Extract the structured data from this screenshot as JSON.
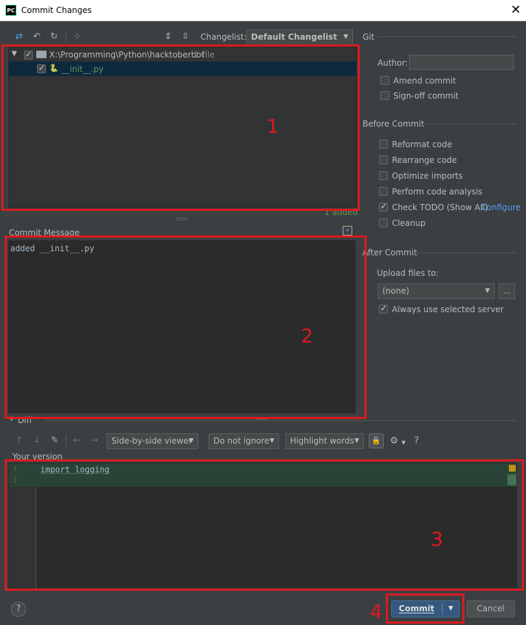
{
  "window": {
    "app_icon": "PC",
    "title": "Commit Changes",
    "close": "✕"
  },
  "toolbar": {
    "changelist_label": "Changelist:",
    "changelist_value": "Default Changelist"
  },
  "tree": {
    "root_label": "X:\\Programming\\Python\\hacktoberbot",
    "root_count": "1 file",
    "file_label": "__init__.py",
    "status_added": "1 added"
  },
  "commit_message": {
    "header": "Commit Message",
    "text": "added __init__.py"
  },
  "git": {
    "header": "Git",
    "author_label": "Author:",
    "author_value": "",
    "amend": "Amend commit",
    "signoff": "Sign-off commit"
  },
  "before_commit": {
    "header": "Before Commit",
    "options": [
      {
        "label": "Reformat code",
        "checked": false
      },
      {
        "label": "Rearrange code",
        "checked": false
      },
      {
        "label": "Optimize imports",
        "checked": false
      },
      {
        "label": "Perform code analysis",
        "checked": false
      },
      {
        "label": "Check TODO (Show All)",
        "checked": true
      },
      {
        "label": "Cleanup",
        "checked": false
      }
    ],
    "configure_link": "Configure"
  },
  "after_commit": {
    "header": "After Commit",
    "upload_label": "Upload files to:",
    "upload_value": "(none)",
    "browse": "...",
    "always_use": "Always use selected server"
  },
  "diff": {
    "header": "Diff",
    "viewer_mode": "Side-by-side viewer",
    "ignore_mode": "Do not ignore",
    "highlight_mode": "Highlight words",
    "help": "?",
    "your_version": "Your version",
    "lines": [
      {
        "num": "1",
        "code": "import logging"
      },
      {
        "num": "2",
        "code": ""
      }
    ]
  },
  "annotations": [
    "1",
    "2",
    "3",
    "4"
  ],
  "buttons": {
    "help": "?",
    "commit": "Commit",
    "cancel": "Cancel"
  },
  "colors": {
    "accent": "#365880",
    "link": "#589df6",
    "annotation": "#e0191f",
    "added_bg": "#294436",
    "file_green": "#629755"
  }
}
